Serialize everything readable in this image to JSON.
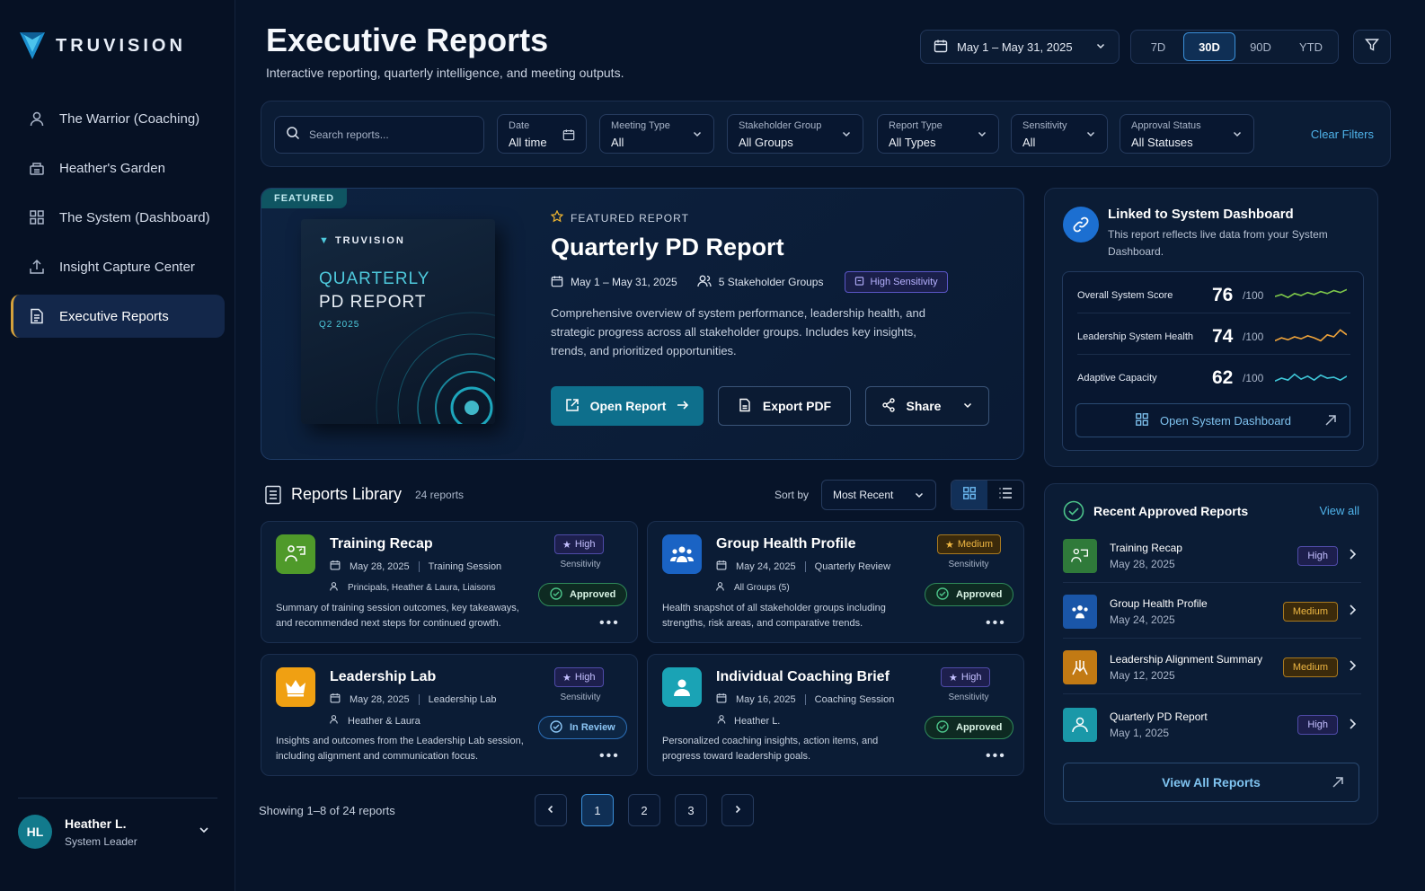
{
  "brand": {
    "name": "TRUVISION"
  },
  "sidebar": {
    "items": [
      {
        "label": "The Warrior (Coaching)",
        "icon": "user-icon"
      },
      {
        "label": "Heather's Garden",
        "icon": "garden-icon"
      },
      {
        "label": "The System (Dashboard)",
        "icon": "grid-icon"
      },
      {
        "label": "Insight Capture Center",
        "icon": "upload-icon"
      },
      {
        "label": "Executive Reports",
        "icon": "document-icon",
        "active": true
      }
    ],
    "user": {
      "initials": "HL",
      "name": "Heather L.",
      "role": "System Leader"
    }
  },
  "header": {
    "title": "Executive Reports",
    "subtitle": "Interactive reporting, quarterly intelligence, and meeting outputs.",
    "date_range": "May 1 – May 31, 2025",
    "periods": [
      "7D",
      "30D",
      "90D",
      "YTD"
    ],
    "active_period": "30D"
  },
  "filters": {
    "search_placeholder": "Search reports...",
    "selects": [
      {
        "label": "Date",
        "value": "All time"
      },
      {
        "label": "Meeting Type",
        "value": "All"
      },
      {
        "label": "Stakeholder Group",
        "value": "All Groups"
      },
      {
        "label": "Report Type",
        "value": "All Types"
      },
      {
        "label": "Sensitivity",
        "value": "All"
      },
      {
        "label": "Approval Status",
        "value": "All Statuses"
      }
    ],
    "clear_label": "Clear Filters"
  },
  "featured": {
    "tag": "FEATURED",
    "book": {
      "logo": "TRUVISION",
      "line1": "QUARTERLY",
      "line2": "PD REPORT",
      "quarter": "Q2 2025"
    },
    "kicker": "FEATURED REPORT",
    "title": "Quarterly PD Report",
    "date": "May 1 – May 31, 2025",
    "groups": "5 Stakeholder Groups",
    "sensitivity": "High Sensitivity",
    "description": "Comprehensive overview of system performance, leadership health, and strategic progress across all stakeholder groups. Includes key insights, trends, and prioritized opportunities.",
    "open_label": "Open Report",
    "export_label": "Export PDF",
    "share_label": "Share"
  },
  "linked": {
    "title": "Linked to System Dashboard",
    "subtitle": "This report reflects live data from your System Dashboard.",
    "metrics": [
      {
        "label": "Overall System Score",
        "value": "76",
        "unit": "/100",
        "color": "#7ec84a",
        "trend": [
          0.45,
          0.55,
          0.4,
          0.6,
          0.5,
          0.65,
          0.55,
          0.7,
          0.6,
          0.75,
          0.65,
          0.8
        ]
      },
      {
        "label": "Leadership System Health",
        "value": "74",
        "unit": "/100",
        "color": "#f0a43a",
        "trend": [
          0.3,
          0.45,
          0.35,
          0.5,
          0.4,
          0.55,
          0.45,
          0.3,
          0.6,
          0.5,
          0.85,
          0.6
        ]
      },
      {
        "label": "Adaptive Capacity",
        "value": "62",
        "unit": "/100",
        "color": "#3fc7d8",
        "trend": [
          0.35,
          0.5,
          0.4,
          0.7,
          0.45,
          0.6,
          0.4,
          0.65,
          0.5,
          0.55,
          0.4,
          0.6
        ]
      }
    ],
    "open_label": "Open System Dashboard"
  },
  "library": {
    "title": "Reports Library",
    "count": "24 reports",
    "sort_label": "Sort by",
    "sort_value": "Most Recent",
    "cards": [
      {
        "title": "Training Recap",
        "date": "May 28, 2025",
        "type": "Training Session",
        "people": "Principals, Heather & Laura, Liaisons",
        "desc": "Summary of training session outcomes, key takeaways, and recommended next steps for continued growth.",
        "sensitivity": "High",
        "sens_label": "Sensitivity",
        "status": "Approved",
        "icon_color": "#4f9a2a"
      },
      {
        "title": "Group Health Profile",
        "date": "May 24, 2025",
        "type": "Quarterly Review",
        "people": "All Groups (5)",
        "desc": "Health snapshot of all stakeholder groups including strengths, risk areas, and comparative trends.",
        "sensitivity": "Medium",
        "sens_label": "Sensitivity",
        "status": "Approved",
        "icon_color": "#1a63c4"
      },
      {
        "title": "Leadership Lab",
        "date": "May 28, 2025",
        "type": "Leadership Lab",
        "people": "Heather & Laura",
        "desc": "Insights and outcomes from the Leadership Lab session, including alignment and communication focus.",
        "sensitivity": "High",
        "sens_label": "Sensitivity",
        "status": "In Review",
        "icon_color": "#f0a012"
      },
      {
        "title": "Individual Coaching Brief",
        "date": "May 16, 2025",
        "type": "Coaching Session",
        "people": "Heather L.",
        "desc": "Personalized coaching insights, action items, and progress toward leadership goals.",
        "sensitivity": "High",
        "sens_label": "Sensitivity",
        "status": "Approved",
        "icon_color": "#1aa3b5"
      }
    ],
    "showing": "Showing 1–8 of 24 reports",
    "pages": [
      "1",
      "2",
      "3"
    ]
  },
  "recent": {
    "title": "Recent Approved Reports",
    "view_all": "View all",
    "items": [
      {
        "name": "Training Recap",
        "date": "May 28, 2025",
        "sensitivity": "High",
        "icon_color": "#2f7a3a"
      },
      {
        "name": "Group Health Profile",
        "date": "May 24, 2025",
        "sensitivity": "Medium",
        "icon_color": "#1a56a8"
      },
      {
        "name": "Leadership Alignment Summary",
        "date": "May 12, 2025",
        "sensitivity": "Medium",
        "icon_color": "#c27a14"
      },
      {
        "name": "Quarterly PD Report",
        "date": "May 1, 2025",
        "sensitivity": "High",
        "icon_color": "#1a98a8"
      }
    ],
    "view_all_btn": "View All Reports"
  }
}
